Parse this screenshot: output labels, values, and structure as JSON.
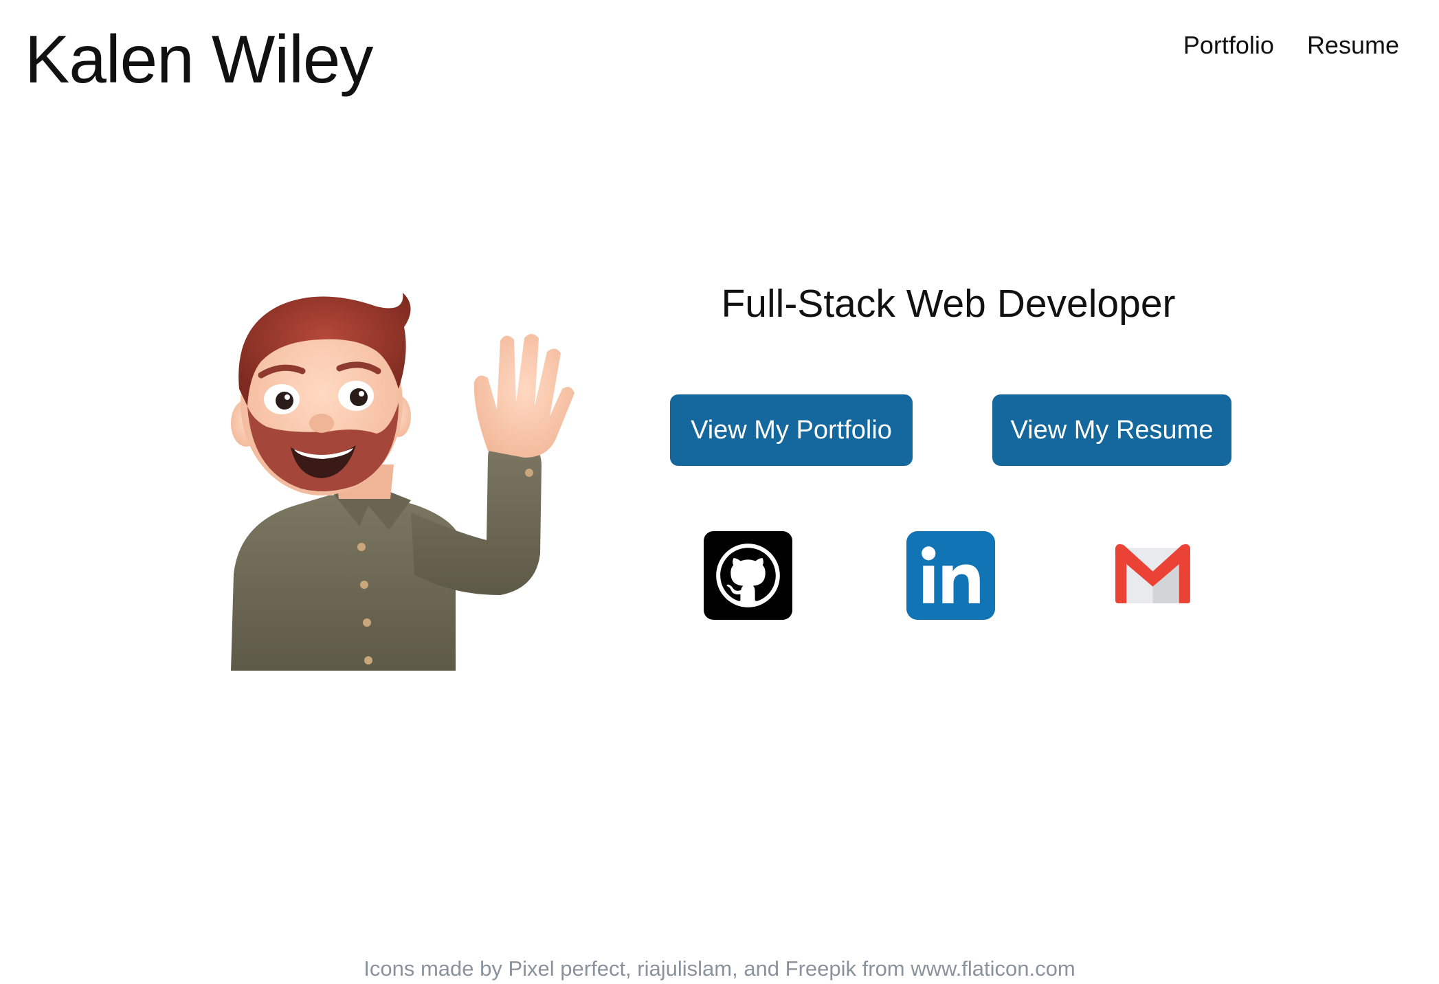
{
  "header": {
    "title": "Kalen Wiley",
    "nav": [
      {
        "label": "Portfolio"
      },
      {
        "label": "Resume"
      }
    ]
  },
  "hero": {
    "avatar_icon": "waving-memoji-avatar",
    "tagline": "Full-Stack Web Developer",
    "buttons": {
      "portfolio_label": "View My Portfolio",
      "resume_label": "View My Resume"
    },
    "social": [
      {
        "icon": "github-icon"
      },
      {
        "icon": "linkedin-icon"
      },
      {
        "icon": "gmail-icon"
      }
    ]
  },
  "footer": {
    "credits": "Icons made by Pixel perfect, riajulislam, and Freepik from www.flaticon.com"
  },
  "colors": {
    "button_bg": "#14689e",
    "linkedin": "#1174b5",
    "gmail_red": "#ea4335",
    "credits_text": "#8a939c"
  }
}
